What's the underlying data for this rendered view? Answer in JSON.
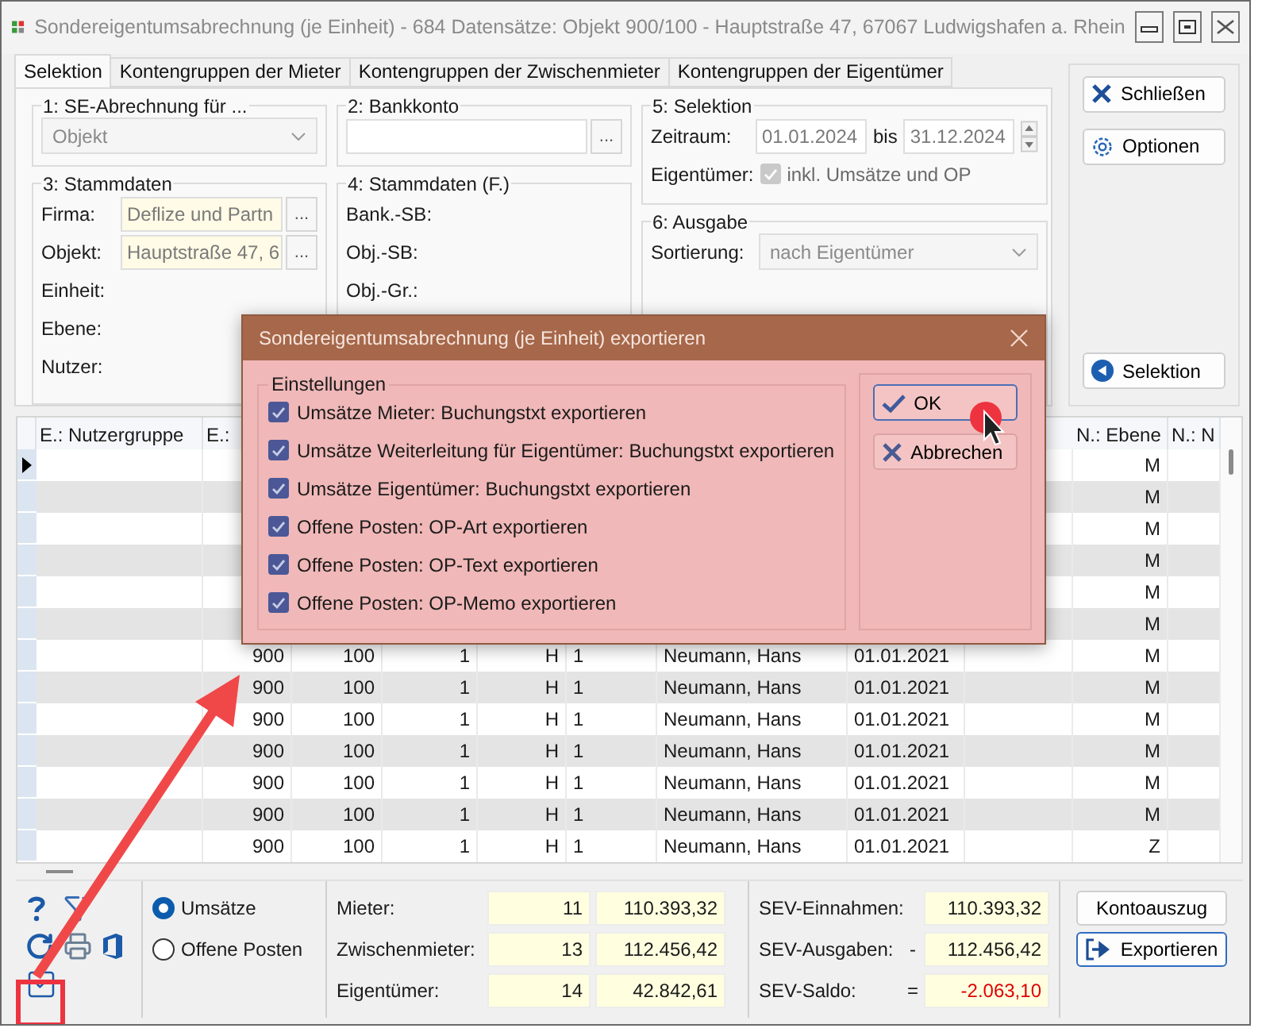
{
  "window": {
    "title": "Sondereigentumsabrechnung (je Einheit) - 684 Datensätze:  Objekt 900/100 - Hauptstraße 47, 67067 Ludwigshafen a. Rhein"
  },
  "tabs": [
    {
      "label": "Selektion",
      "selected": true
    },
    {
      "label": "Kontengruppen der Mieter",
      "selected": false
    },
    {
      "label": "Kontengruppen der Zwischenmieter",
      "selected": false
    },
    {
      "label": "Kontengruppen der Eigentümer",
      "selected": false
    }
  ],
  "se_abrechnung": {
    "legend": "1: SE-Abrechnung für ...",
    "value": "Objekt",
    "disabled": true
  },
  "bankkonto": {
    "legend": "2: Bankkonto",
    "button": "..."
  },
  "stammdaten": {
    "legend": "3: Stammdaten",
    "fields": [
      {
        "label": "Firma:",
        "value": "Deflize und Partn",
        "button": "..."
      },
      {
        "label": "Objekt:",
        "value": "Hauptstraße 47, 6",
        "button": "..."
      },
      {
        "label": "Einheit:"
      },
      {
        "label": "Ebene:"
      },
      {
        "label": "Nutzer:"
      }
    ]
  },
  "stammdaten_f": {
    "legend": "4: Stammdaten (F.)",
    "fields": [
      {
        "label": "Bank.-SB:"
      },
      {
        "label": "Obj.-SB:"
      },
      {
        "label": "Obj.-Gr.:"
      }
    ]
  },
  "selektion": {
    "legend": "5: Selektion",
    "period_label": "Zeitraum:",
    "from": "01.01.2024",
    "between": "bis",
    "to": "31.12.2024",
    "owner_label": "Eigentümer:",
    "include_label": "inkl. Umsätze und OP",
    "include_checked": true,
    "include_disabled": true
  },
  "ausgabe": {
    "legend": "6: Ausgabe",
    "label": "Sortierung:",
    "value": "nach Eigentümer"
  },
  "side_buttons": [
    {
      "label": "Schließen"
    },
    {
      "label": "Optionen"
    },
    {
      "label": "Selektion"
    }
  ],
  "grid": {
    "columns": [
      "E.: Nutzergruppe",
      "E.:",
      null,
      null,
      null,
      null,
      null,
      null,
      null,
      "N.: Ebene",
      "N.: N"
    ],
    "rows": [
      {
        "current": true,
        "cells": [
          null,
          null,
          null,
          null,
          null,
          null,
          null,
          null,
          null,
          "M",
          null
        ]
      },
      {
        "current": false,
        "cells": [
          null,
          null,
          null,
          null,
          null,
          null,
          null,
          null,
          null,
          "M",
          null
        ]
      },
      {
        "current": false,
        "cells": [
          null,
          null,
          null,
          null,
          null,
          null,
          null,
          null,
          null,
          "M",
          null
        ]
      },
      {
        "current": false,
        "cells": [
          null,
          null,
          null,
          null,
          null,
          null,
          null,
          null,
          null,
          "M",
          null
        ]
      },
      {
        "current": false,
        "cells": [
          null,
          null,
          null,
          null,
          null,
          null,
          null,
          null,
          null,
          "M",
          null
        ]
      },
      {
        "current": false,
        "cells": [
          null,
          null,
          null,
          null,
          null,
          null,
          null,
          null,
          null,
          "M",
          null
        ]
      },
      {
        "current": false,
        "cells": [
          null,
          "900",
          "100",
          "1",
          "H",
          "1",
          "Neumann, Hans",
          "01.01.2021",
          null,
          "M",
          null
        ]
      },
      {
        "current": false,
        "cells": [
          null,
          "900",
          "100",
          "1",
          "H",
          "1",
          "Neumann, Hans",
          "01.01.2021",
          null,
          "M",
          null
        ]
      },
      {
        "current": false,
        "cells": [
          null,
          "900",
          "100",
          "1",
          "H",
          "1",
          "Neumann, Hans",
          "01.01.2021",
          null,
          "M",
          null
        ]
      },
      {
        "current": false,
        "cells": [
          null,
          "900",
          "100",
          "1",
          "H",
          "1",
          "Neumann, Hans",
          "01.01.2021",
          null,
          "M",
          null
        ]
      },
      {
        "current": false,
        "cells": [
          null,
          "900",
          "100",
          "1",
          "H",
          "1",
          "Neumann, Hans",
          "01.01.2021",
          null,
          "M",
          null
        ]
      },
      {
        "current": false,
        "cells": [
          null,
          "900",
          "100",
          "1",
          "H",
          "1",
          "Neumann, Hans",
          "01.01.2021",
          null,
          "M",
          null
        ]
      },
      {
        "current": false,
        "cells": [
          null,
          "900",
          "100",
          "1",
          "H",
          "1",
          "Neumann, Hans",
          "01.01.2021",
          null,
          "Z",
          null
        ]
      }
    ]
  },
  "mode": [
    {
      "label": "Umsätze",
      "selected": true
    },
    {
      "label": "Offene Posten",
      "selected": false
    }
  ],
  "counts": [
    {
      "label": "Mieter:",
      "count": "11",
      "amount": "110.393,32"
    },
    {
      "label": "Zwischenmieter:",
      "count": "13",
      "amount": "112.456,42"
    },
    {
      "label": "Eigentümer:",
      "count": "14",
      "amount": "42.842,61"
    }
  ],
  "sev": [
    {
      "label": "SEV-Einnahmen:",
      "value": "110.393,32",
      "negative": false
    },
    {
      "label": "SEV-Ausgaben:",
      "sign": "-",
      "value": "112.456,42",
      "negative": false
    },
    {
      "label": "SEV-Saldo:",
      "sign": "=",
      "value": "-2.063,10",
      "negative": true
    }
  ],
  "actions": [
    {
      "label": "Kontoauszug",
      "focused": false
    },
    {
      "label": "Exportieren",
      "focused": true
    }
  ],
  "dialog": {
    "title": "Sondereigentumsabrechnung (je Einheit) exportieren",
    "group": "Einstellungen",
    "options": [
      {
        "label": "Umsätze Mieter: Buchungstxt exportieren",
        "checked": true
      },
      {
        "label": "Umsätze Weiterleitung für Eigentümer: Buchungstxt exportieren",
        "checked": true
      },
      {
        "label": "Umsätze Eigentümer: Buchungstxt exportieren",
        "checked": true
      },
      {
        "label": "Offene Posten: OP-Art exportieren",
        "checked": true
      },
      {
        "label": "Offene Posten: OP-Text exportieren",
        "checked": true
      },
      {
        "label": "Offene Posten: OP-Memo exportieren",
        "checked": true
      }
    ],
    "buttons": [
      {
        "label": "OK",
        "focused": true
      },
      {
        "label": "Abbrechen",
        "focused": false
      }
    ]
  }
}
